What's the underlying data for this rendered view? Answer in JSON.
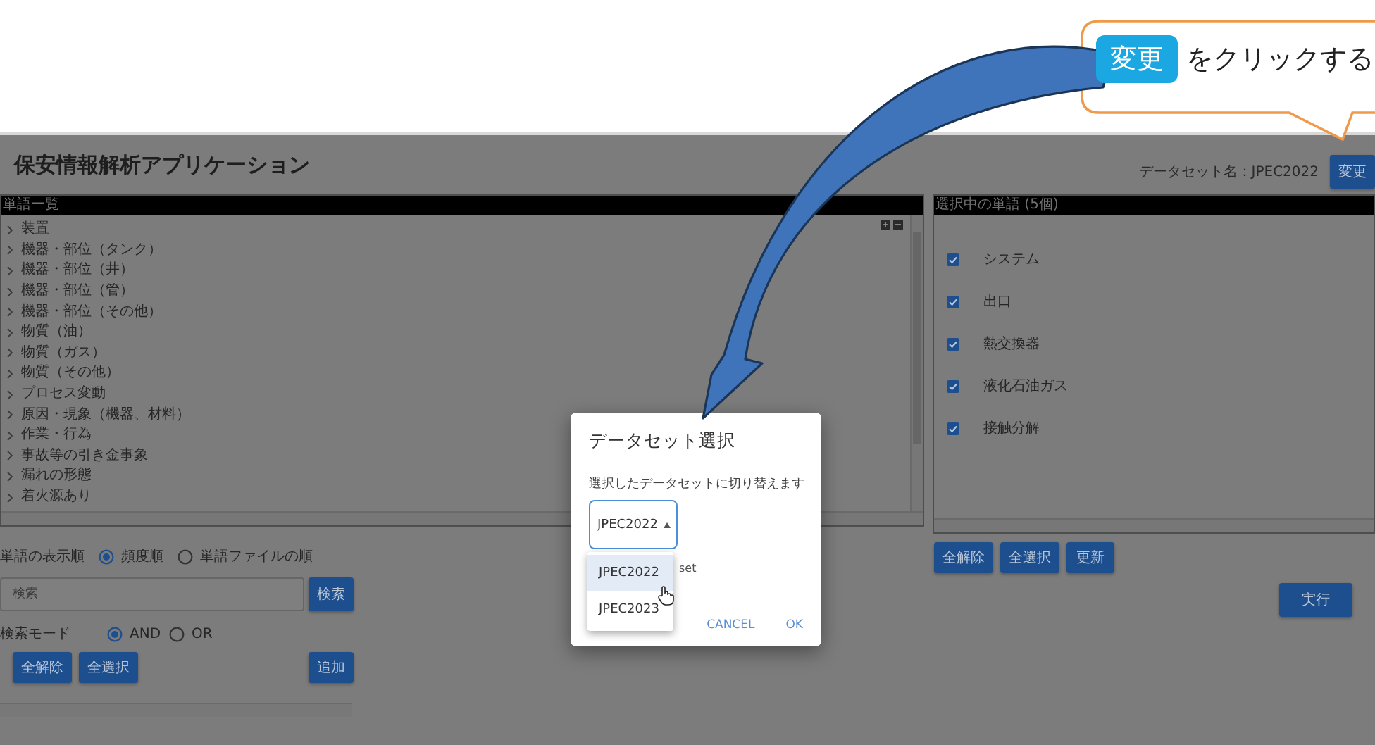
{
  "callout": {
    "badge": "変更",
    "text": "をクリックする"
  },
  "header": {
    "title": "保安情報解析アプリケーション",
    "dataset_label": "データセット名：JPEC2022",
    "change_button": "変更"
  },
  "word_list": {
    "header": "単語一覧",
    "items": [
      {
        "label": "装置",
        "expanded": false
      },
      {
        "label": "機器・部位（タンク）",
        "expanded": false
      },
      {
        "label": "機器・部位（井）",
        "expanded": false
      },
      {
        "label": "機器・部位（管）",
        "expanded": false
      },
      {
        "label": "機器・部位（その他）",
        "expanded": false
      },
      {
        "label": "物質（油）",
        "expanded": false
      },
      {
        "label": "物質（ガス）",
        "expanded": false
      },
      {
        "label": "物質（その他）",
        "expanded": false
      },
      {
        "label": "プロセス変動",
        "expanded": false
      },
      {
        "label": "原因・現象（機器、材料）",
        "expanded": false
      },
      {
        "label": "作業・行為",
        "expanded": false
      },
      {
        "label": "事故等の引き金事象",
        "expanded": false
      },
      {
        "label": "漏れの形態",
        "expanded": false
      },
      {
        "label": "着火源あり",
        "expanded": false
      }
    ]
  },
  "display_order": {
    "label": "単語の表示順",
    "options": [
      {
        "label": "頻度順",
        "selected": true
      },
      {
        "label": "単語ファイルの順",
        "selected": false
      }
    ]
  },
  "search": {
    "placeholder": "検索",
    "button": "検索"
  },
  "search_mode": {
    "label": "検索モード",
    "options": [
      {
        "label": "AND",
        "selected": true
      },
      {
        "label": "OR",
        "selected": false
      }
    ]
  },
  "left_buttons": [
    "全解除",
    "全選択"
  ],
  "add_button": "追加",
  "selected_words": {
    "header": "選択中の単語 (5個)",
    "items": [
      {
        "label": "システム",
        "checked": true
      },
      {
        "label": "出口",
        "checked": true
      },
      {
        "label": "熱交換器",
        "checked": true
      },
      {
        "label": "液化石油ガス",
        "checked": true
      },
      {
        "label": "接触分解",
        "checked": true
      }
    ]
  },
  "right_buttons": [
    "全解除",
    "全選択",
    "更新"
  ],
  "run_button": "実行",
  "dialog": {
    "title": "データセット選択",
    "message": "選択したデータセットに切り替えます",
    "select_value": "JPEC2022",
    "helper_fragment": "set",
    "options": [
      {
        "label": "JPEC2022",
        "selected": true
      },
      {
        "label": "JPEC2023",
        "selected": false
      }
    ],
    "buttons": [
      "CANCEL",
      "OK"
    ]
  }
}
